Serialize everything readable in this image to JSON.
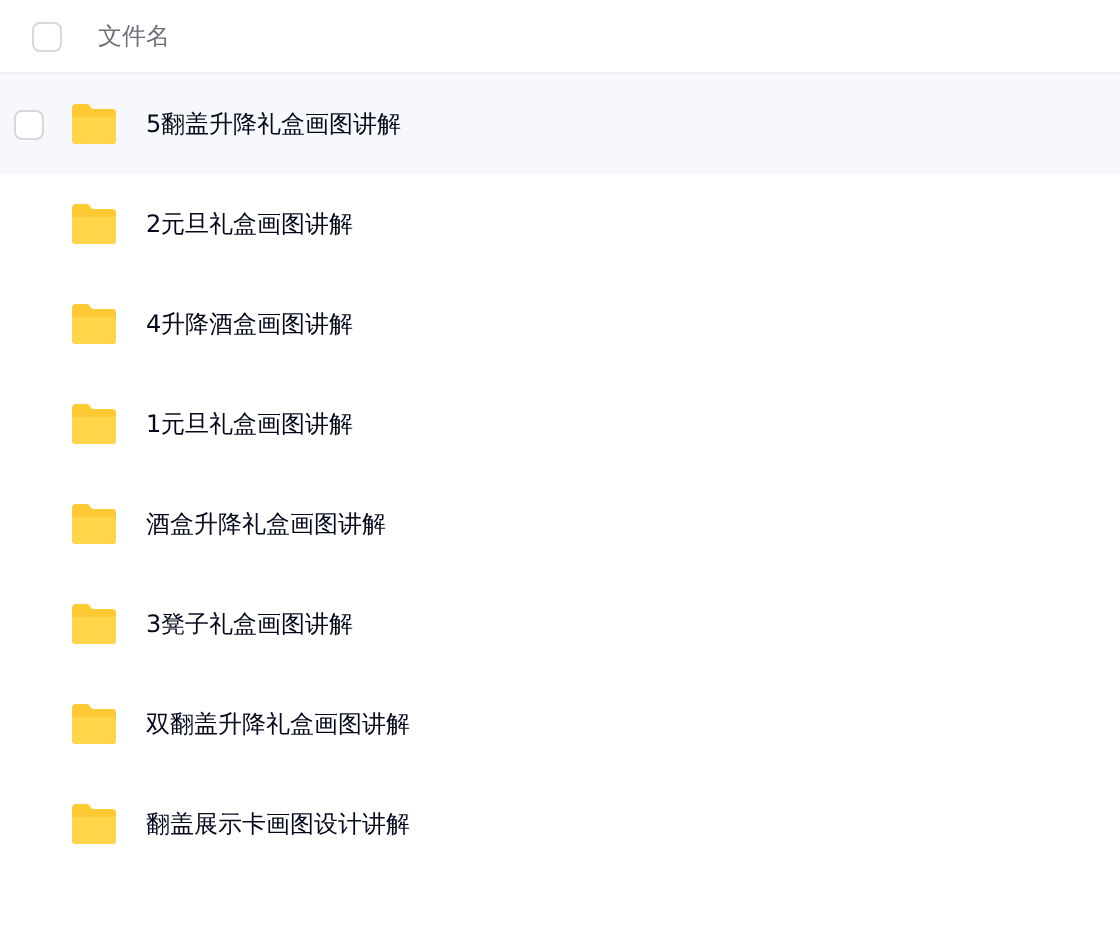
{
  "header": {
    "checked": false,
    "label": "文件名"
  },
  "rows": [
    {
      "name": "5翻盖升降礼盒画图讲解",
      "hovered": true,
      "checked": false
    },
    {
      "name": "2元旦礼盒画图讲解",
      "hovered": false,
      "checked": false
    },
    {
      "name": "4升降酒盒画图讲解",
      "hovered": false,
      "checked": false
    },
    {
      "name": "1元旦礼盒画图讲解",
      "hovered": false,
      "checked": false
    },
    {
      "name": "酒盒升降礼盒画图讲解",
      "hovered": false,
      "checked": false
    },
    {
      "name": "3凳子礼盒画图讲解",
      "hovered": false,
      "checked": false
    },
    {
      "name": "双翻盖升降礼盒画图讲解",
      "hovered": false,
      "checked": false
    },
    {
      "name": "翻盖展示卡画图设计讲解",
      "hovered": false,
      "checked": false
    }
  ]
}
